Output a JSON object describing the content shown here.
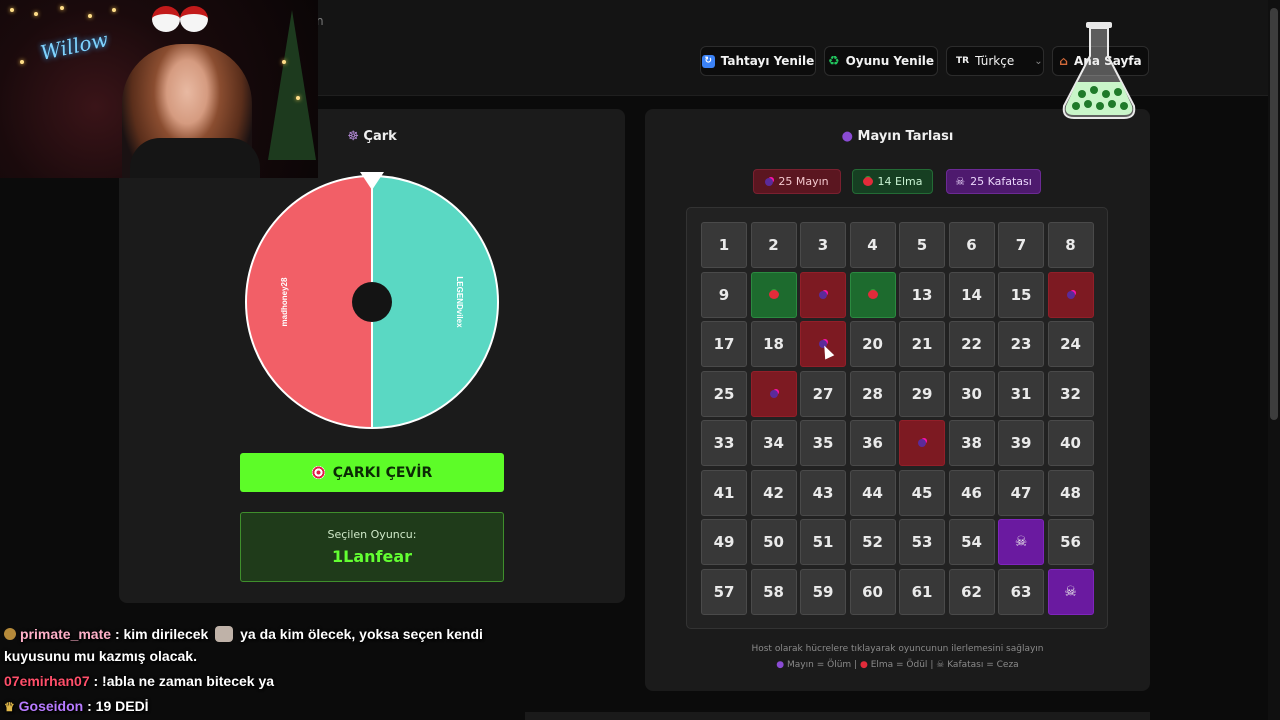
{
  "header": {
    "title_fragment": "n",
    "refresh_board_label": "Tahtayı Yenile",
    "reset_game_label": "Oyunu Yenile",
    "language_flag": "TR",
    "language_label": "Türkçe",
    "home_label": "Ana Sayfa"
  },
  "webcam": {
    "neon_text": "Willow"
  },
  "wheel": {
    "title": "Çark",
    "segments": [
      {
        "label": "madhoney28",
        "color": "#f25f67"
      },
      {
        "label": "LEGENDvilex",
        "color": "#5ad8c3"
      }
    ],
    "spin_button": "ÇARKI ÇEVİR",
    "selected_label": "Seçilen Oyuncu:",
    "selected_player": "1Lanfear"
  },
  "minefield": {
    "title": "Mayın Tarlası",
    "badges": {
      "mines": "25 Mayın",
      "apples": "14 Elma",
      "skulls": "25 Kafatası"
    },
    "cells": [
      "1",
      "2",
      "3",
      "4",
      "5",
      "6",
      "7",
      "8",
      "9",
      "apple",
      "mine",
      "apple",
      "13",
      "14",
      "15",
      "mine",
      "17",
      "18",
      "mine",
      "20",
      "21",
      "22",
      "23",
      "24",
      "25",
      "mine",
      "27",
      "28",
      "29",
      "30",
      "31",
      "32",
      "33",
      "34",
      "35",
      "36",
      "mine",
      "38",
      "39",
      "40",
      "41",
      "42",
      "43",
      "44",
      "45",
      "46",
      "47",
      "48",
      "49",
      "50",
      "51",
      "52",
      "53",
      "54",
      "skull",
      "56",
      "57",
      "58",
      "59",
      "60",
      "61",
      "62",
      "63",
      "skull"
    ],
    "help_line1": "Host olarak hücrelere tıklayarak oyuncunun ilerlemesini sağlayın",
    "help_legend": {
      "mine": "Mayın = Ölüm",
      "apple": "Elma = Ödül",
      "skull": "Kafatası = Ceza",
      "separator": "|"
    }
  },
  "chat": [
    {
      "user": "primate_mate",
      "color": "#ffb0c8",
      "text_before": ": kim dirilecek",
      "text_after": "ya da kim ölecek, yoksa seçen kendi kuyusunu mu kazmış olacak."
    },
    {
      "user": "07emirhan07",
      "color": "#ff4f6a",
      "text_before": ": !abla ne zaman bitecek ya",
      "text_after": ""
    },
    {
      "user": "Goseidon",
      "color": "#b77bff",
      "text_before": ": 19 DEDİ",
      "text_after": ""
    }
  ],
  "colors": {
    "accent_green": "#5dfc28",
    "mine": "#7d1a22",
    "apple": "#1d6b2e",
    "skull": "#6a1aa0"
  }
}
